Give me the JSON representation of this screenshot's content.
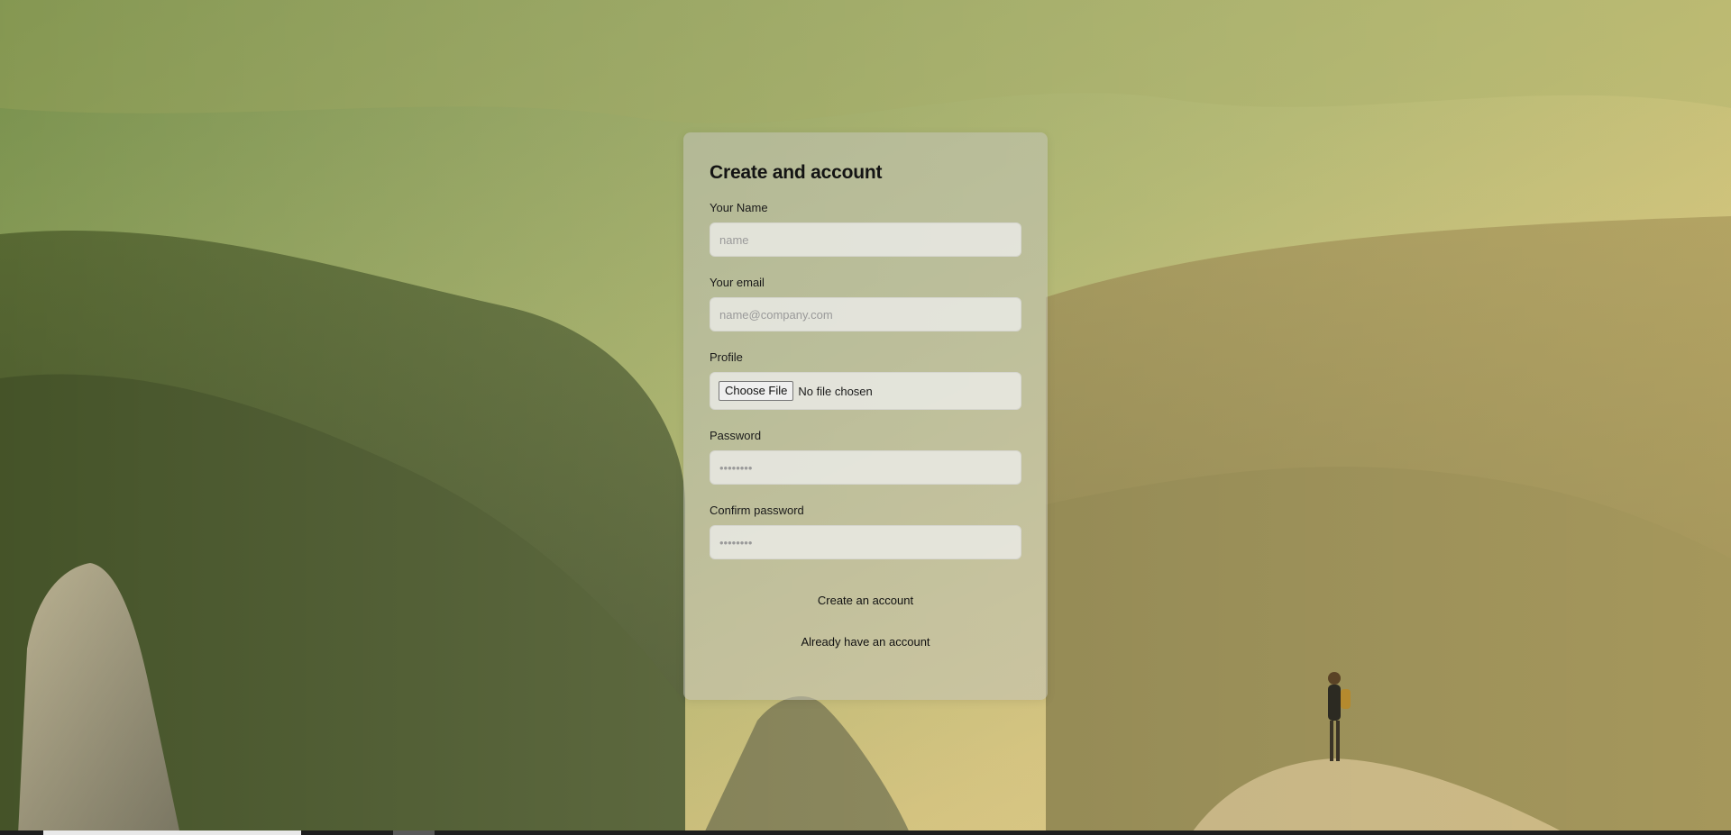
{
  "form": {
    "title": "Create and account",
    "name_label": "Your Name",
    "name_placeholder": "name",
    "email_label": "Your email",
    "email_placeholder": "name@company.com",
    "profile_label": "Profile",
    "file_button_label": "Choose File",
    "file_status": "No file chosen",
    "password_label": "Password",
    "password_placeholder": "••••••••",
    "confirm_label": "Confirm password",
    "confirm_placeholder": "••••••••",
    "submit_label": "Create an account",
    "login_link_label": "Already have an account"
  },
  "background": {
    "image": "mountain-landscape-hiker"
  }
}
